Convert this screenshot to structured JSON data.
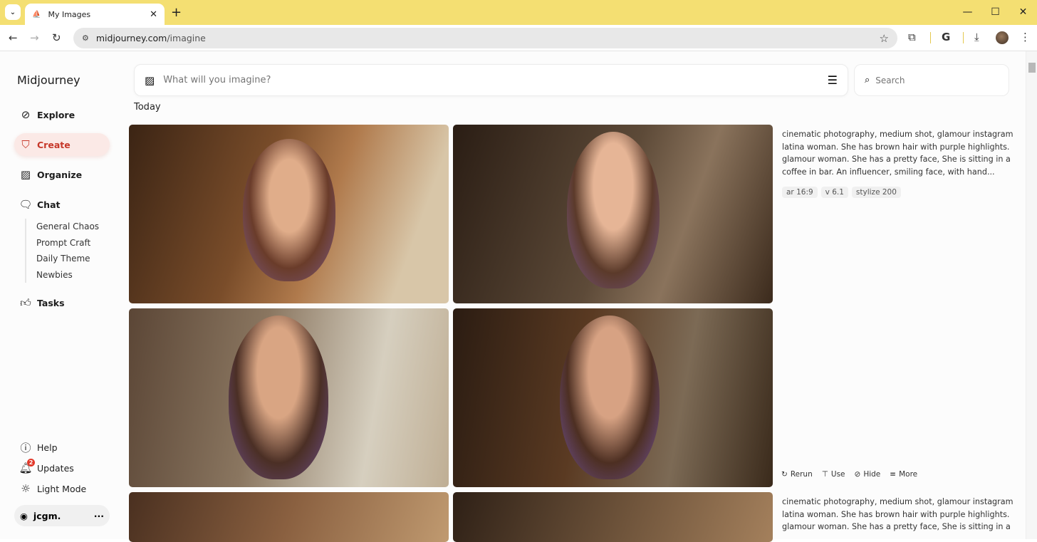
{
  "browser": {
    "tab_title": "My Images",
    "url_domain": "midjourney.com",
    "url_path": "/imagine"
  },
  "sidebar": {
    "logo": "Midjourney",
    "items": [
      {
        "label": "Explore",
        "icon": "compass-icon"
      },
      {
        "label": "Create",
        "icon": "brush-icon"
      },
      {
        "label": "Organize",
        "icon": "image-icon"
      },
      {
        "label": "Chat",
        "icon": "chat-icon"
      },
      {
        "label": "Tasks",
        "icon": "thumbs-up-icon"
      }
    ],
    "chat_channels": [
      "General Chaos",
      "Prompt Craft",
      "Daily Theme",
      "Newbies"
    ],
    "bottom": [
      {
        "label": "Help"
      },
      {
        "label": "Updates",
        "badge": "2"
      },
      {
        "label": "Light Mode"
      }
    ],
    "user": "jcgm.",
    "user_more": "···"
  },
  "prompt": {
    "placeholder": "What will you imagine?"
  },
  "search": {
    "placeholder": "Search"
  },
  "section_title": "Today",
  "jobs": [
    {
      "prompt": "cinematic photography, medium shot, glamour instagram latina woman. She has brown hair with purple highlights. glamour woman. She has a pretty face, She is sitting in a coffee in bar. An influencer, smiling face, with hand...",
      "tags": [
        "ar 16:9",
        "v 6.1",
        "stylize 200"
      ],
      "actions": [
        "Rerun",
        "Use",
        "Hide",
        "More"
      ]
    },
    {
      "prompt": "cinematic photography, medium shot, glamour instagram latina woman. She has brown hair with purple highlights. glamour woman. She has a pretty face, She is sitting in a"
    }
  ],
  "colors": {
    "accent": "#c6382a",
    "tabbar": "#f4df72"
  }
}
